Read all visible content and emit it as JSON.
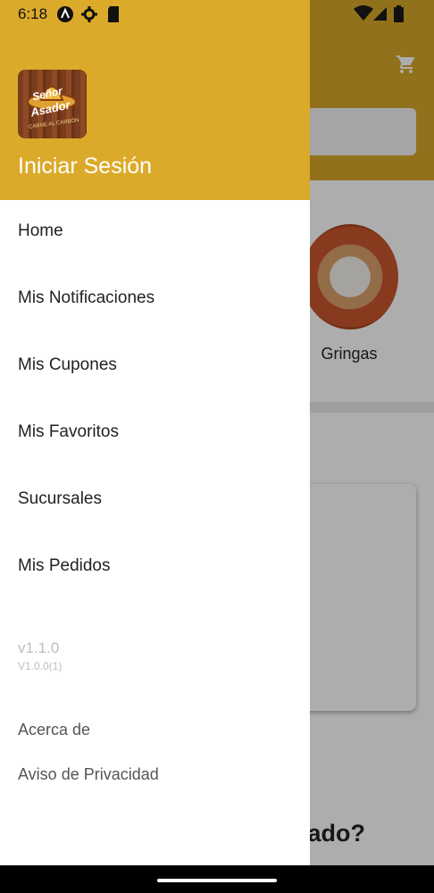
{
  "status_bar": {
    "time": "6:18",
    "left_icons": [
      "a-circle-icon",
      "gear-icon",
      "sd-card-icon"
    ],
    "right_icons": [
      "wifi-icon",
      "signal-icon",
      "battery-icon"
    ]
  },
  "background_app": {
    "header_color": "#d6a72a",
    "cart_icon": "cart-icon",
    "category_label": "Gringas",
    "section_heading_partial": "rado?"
  },
  "drawer": {
    "header_color": "#dcaa2a",
    "logo": {
      "name": "senor-asador-logo",
      "line1": "Señor",
      "line2": "Asador",
      "tagline": "CARNE AL CARBÓN"
    },
    "login_label": "Iniciar Sesión",
    "menu_items": [
      {
        "label": "Home"
      },
      {
        "label": "Mis Notificaciones"
      },
      {
        "label": "Mis Cupones"
      },
      {
        "label": "Mis Favoritos"
      },
      {
        "label": "Sucursales"
      },
      {
        "label": "Mis Pedidos"
      }
    ],
    "version": "v1.1.0",
    "build": "V1.0.0(1)",
    "footer_links": [
      {
        "label": "Acerca de"
      },
      {
        "label": "Aviso de Privacidad"
      }
    ]
  }
}
